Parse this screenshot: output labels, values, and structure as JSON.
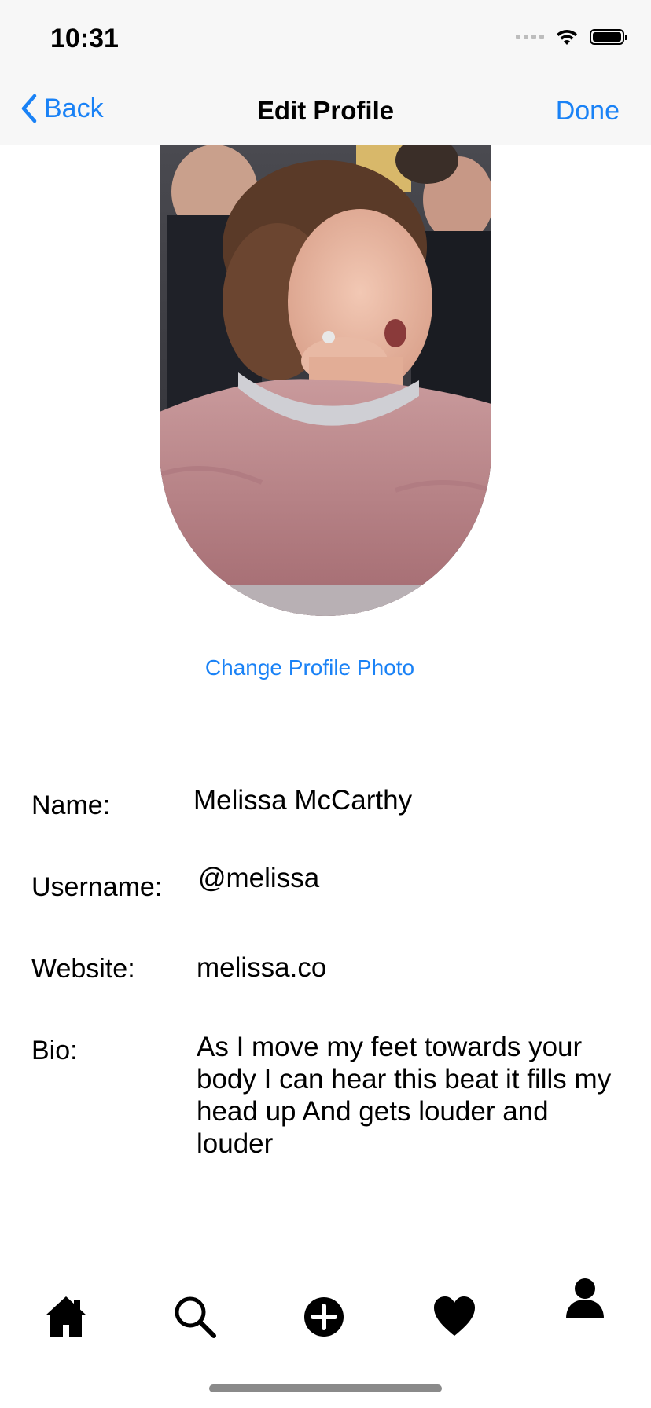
{
  "status": {
    "time": "10:31"
  },
  "nav": {
    "back_label": "Back",
    "title": "Edit Profile",
    "done_label": "Done"
  },
  "profile": {
    "change_photo_label": "Change Profile Photo",
    "fields": {
      "name_label": "Name:",
      "name_value": "Melissa McCarthy",
      "username_label": "Username:",
      "username_value": "@melissa",
      "website_label": "Website:",
      "website_value": "melissa.co",
      "bio_label": "Bio:",
      "bio_value": "As I move my feet towards your body I can hear this beat it fills my head up And gets louder and louder"
    }
  },
  "tabs": [
    "home-icon",
    "search-icon",
    "add-icon",
    "heart-icon",
    "profile-icon"
  ],
  "colors": {
    "accent": "#1a82f6",
    "bar_background": "#f7f7f7"
  }
}
